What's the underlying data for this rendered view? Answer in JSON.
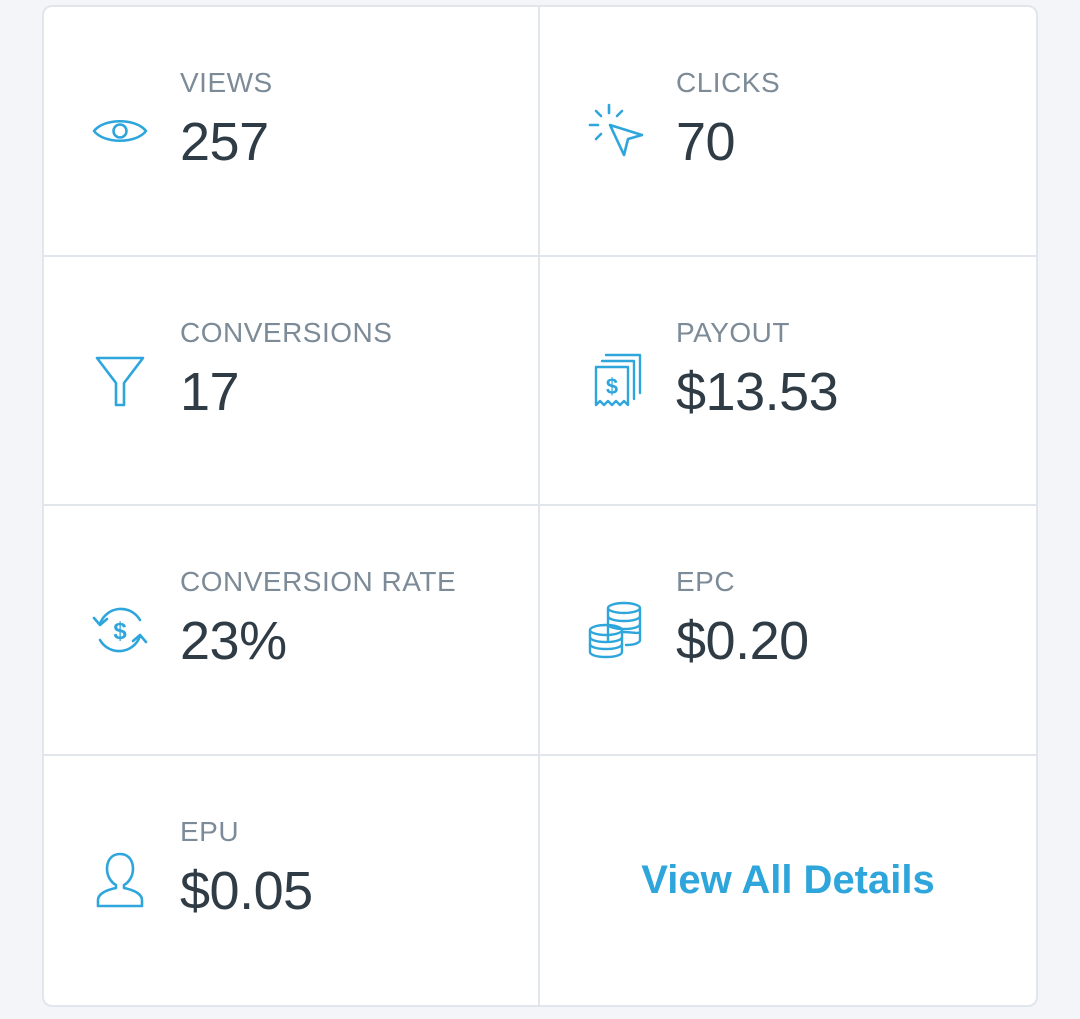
{
  "theme": {
    "accent": "#2ea6dc",
    "label_color": "#7c8b97",
    "value_color": "#2f3c46",
    "border_color": "#e1e6ec"
  },
  "stats": {
    "views": {
      "label": "VIEWS",
      "value": "257",
      "icon": "eye-icon"
    },
    "clicks": {
      "label": "CLICKS",
      "value": "70",
      "icon": "cursor-click-icon"
    },
    "conversions": {
      "label": "CONVERSIONS",
      "value": "17",
      "icon": "funnel-icon"
    },
    "payout": {
      "label": "PAYOUT",
      "value": "$13.53",
      "icon": "dollar-bills-icon"
    },
    "conversion_rate": {
      "label": "CONVERSION RATE",
      "value": "23%",
      "icon": "dollar-cycle-icon"
    },
    "epc": {
      "label": "EPC",
      "value": "$0.20",
      "icon": "coin-stack-icon"
    },
    "epu": {
      "label": "EPU",
      "value": "$0.05",
      "icon": "user-icon"
    }
  },
  "details_link": {
    "label": "View All Details"
  }
}
